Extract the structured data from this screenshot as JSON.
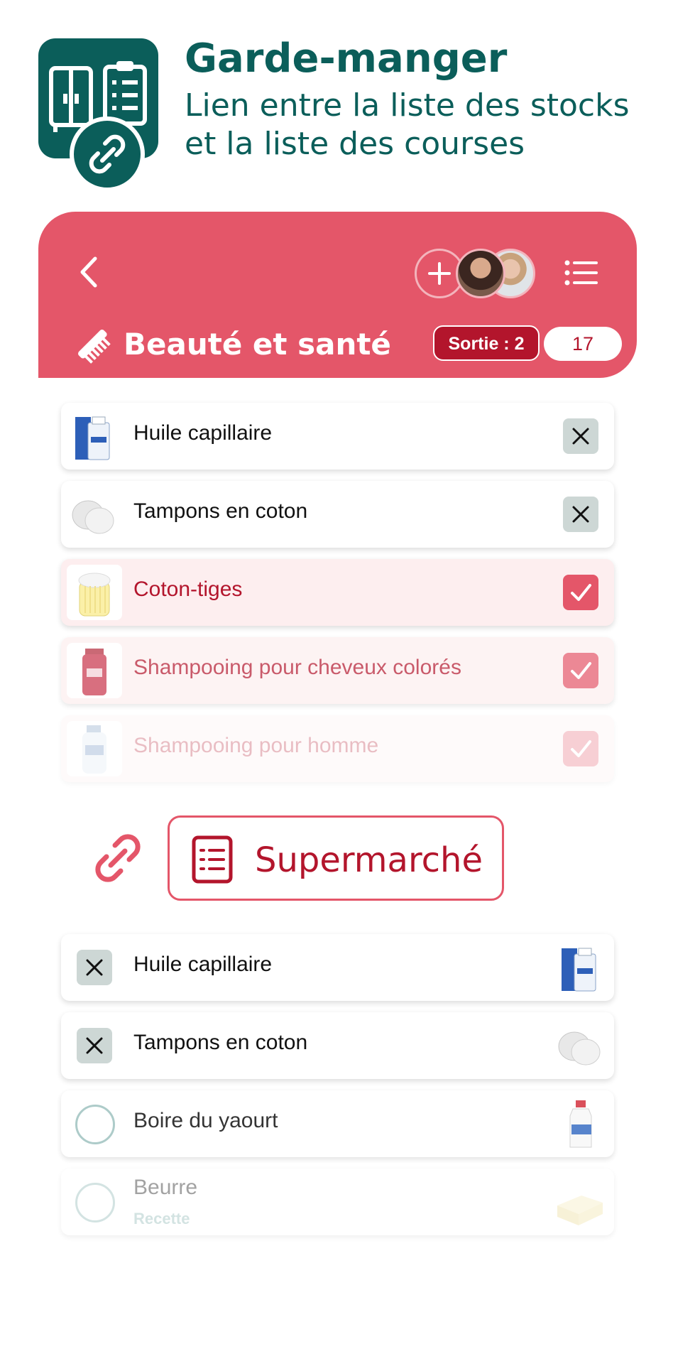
{
  "hero": {
    "title": "Garde-manger",
    "subtitle": "Lien entre la liste des stocks et la liste des courses"
  },
  "list": {
    "title": "Beauté et santé",
    "out_badge": "Sortie : 2",
    "count": "17",
    "items": [
      {
        "label": "Huile capillaire",
        "state": "x"
      },
      {
        "label": "Tampons en coton",
        "state": "x"
      },
      {
        "label": "Coton-tiges",
        "state": "checked"
      },
      {
        "label": "Shampooing pour cheveux colorés",
        "state": "checked"
      },
      {
        "label": "Shampooing pour homme",
        "state": "checked"
      }
    ]
  },
  "linked": {
    "button_label": "Supermarché",
    "items": [
      {
        "label": "Huile capillaire",
        "state": "x"
      },
      {
        "label": "Tampons en coton",
        "state": "x"
      },
      {
        "label": "Boire du yaourt",
        "state": "empty"
      },
      {
        "label": "Beurre",
        "sub": "Recette",
        "state": "empty"
      }
    ]
  },
  "colors": {
    "brand_teal": "#0b5e5a",
    "accent_red": "#e45669",
    "dark_red": "#b3152c"
  }
}
